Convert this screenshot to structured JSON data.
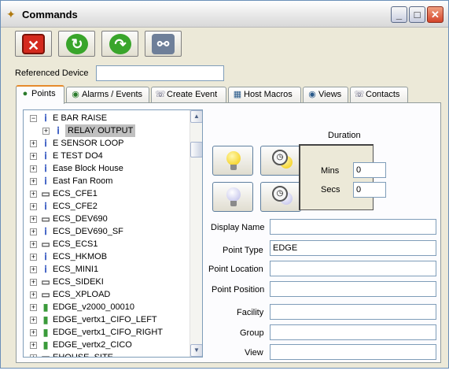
{
  "window": {
    "title": "Commands"
  },
  "title_buttons": {
    "minimize": "_",
    "maximize": "□",
    "close": "✕"
  },
  "toolbar": {
    "buttons": [
      {
        "name": "cancel",
        "color": "#d42a1e",
        "glyph": "✕"
      },
      {
        "name": "refresh",
        "color": "#39a52b",
        "glyph": "↻"
      },
      {
        "name": "redo",
        "color": "#39a52b",
        "glyph": "↷"
      },
      {
        "name": "find",
        "color": "#6e7f99",
        "glyph": "⚯"
      }
    ]
  },
  "referenced_device": {
    "label": "Referenced Device",
    "value": ""
  },
  "tabs": [
    {
      "label": "Points",
      "icon": "points-icon",
      "glyph": "●"
    },
    {
      "label": "Alarms / Events",
      "icon": "alarm-icon",
      "glyph": "◉"
    },
    {
      "label": "Create Event",
      "icon": "phone-icon",
      "glyph": "☏"
    },
    {
      "label": "Host Macros",
      "icon": "grid-icon",
      "glyph": "▦"
    },
    {
      "label": "Views",
      "icon": "eye-icon",
      "glyph": "◉"
    },
    {
      "label": "Contacts",
      "icon": "phone-icon",
      "glyph": "☏"
    }
  ],
  "tree": {
    "rows": [
      {
        "label": "E BAR RAISE",
        "expander": "−",
        "icon": "point",
        "indent": 0
      },
      {
        "label": "RELAY OUTPUT",
        "expander": "+",
        "icon": "point",
        "indent": 1,
        "selected": true
      },
      {
        "label": "E SENSOR LOOP",
        "expander": "+",
        "icon": "point",
        "indent": 0
      },
      {
        "label": "E TEST DO4",
        "expander": "+",
        "icon": "point",
        "indent": 0
      },
      {
        "label": "Ease Block House",
        "expander": "+",
        "icon": "point",
        "indent": 0
      },
      {
        "label": "East Fan Room",
        "expander": "+",
        "icon": "point",
        "indent": 0
      },
      {
        "label": "ECS_CFE1",
        "expander": "+",
        "icon": "device",
        "indent": 0
      },
      {
        "label": "ECS_CFE2",
        "expander": "+",
        "icon": "point",
        "indent": 0
      },
      {
        "label": "ECS_DEV690",
        "expander": "+",
        "icon": "device",
        "indent": 0
      },
      {
        "label": "ECS_DEV690_SF",
        "expander": "+",
        "icon": "point",
        "indent": 0
      },
      {
        "label": "ECS_ECS1",
        "expander": "+",
        "icon": "device",
        "indent": 0
      },
      {
        "label": "ECS_HKMOB",
        "expander": "+",
        "icon": "point",
        "indent": 0
      },
      {
        "label": "ECS_MINI1",
        "expander": "+",
        "icon": "point",
        "indent": 0
      },
      {
        "label": "ECS_SIDEKI",
        "expander": "+",
        "icon": "device",
        "indent": 0
      },
      {
        "label": "ECS_XPLOAD",
        "expander": "+",
        "icon": "device",
        "indent": 0
      },
      {
        "label": "EDGE_v2000_00010",
        "expander": "+",
        "icon": "edge",
        "indent": 0
      },
      {
        "label": "EDGE_vertx1_CIFO_LEFT",
        "expander": "+",
        "icon": "edge",
        "indent": 0
      },
      {
        "label": "EDGE_vertx1_CIFO_RIGHT",
        "expander": "+",
        "icon": "edge",
        "indent": 0
      },
      {
        "label": "EDGE_vertx2_CICO",
        "expander": "+",
        "icon": "edge",
        "indent": 0
      },
      {
        "label": "EHOUSE_SITE",
        "expander": "+",
        "icon": "device",
        "indent": 0
      }
    ]
  },
  "duration": {
    "label": "Duration",
    "mins_label": "Mins",
    "mins_value": "0",
    "secs_label": "Secs",
    "secs_value": "0"
  },
  "fields": [
    {
      "label": "Display Name",
      "value": ""
    },
    {
      "label": "Point Type",
      "value": "EDGE"
    },
    {
      "label": "Point Location",
      "value": ""
    },
    {
      "label": "Point Position",
      "value": ""
    },
    {
      "label": "Facility",
      "value": ""
    },
    {
      "label": "Group",
      "value": ""
    },
    {
      "label": "View",
      "value": ""
    }
  ]
}
